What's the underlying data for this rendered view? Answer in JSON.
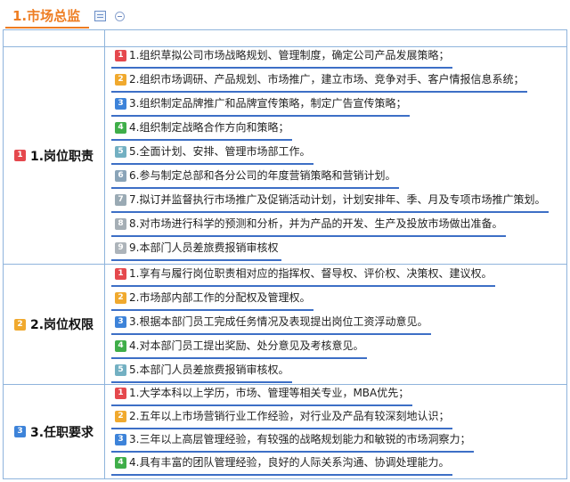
{
  "topic": {
    "title": "1.市场总监"
  },
  "sections": [
    {
      "label": "1.岗位职责",
      "badge": "1",
      "items": [
        {
          "badge": "1",
          "text": "1.组织草拟公司市场战略规划、管理制度，确定公司产品发展策略；"
        },
        {
          "badge": "2",
          "text": "2.组织市场调研、产品规划、市场推广，建立市场、竞争对手、客户情报信息系统；"
        },
        {
          "badge": "3",
          "text": "3.组织制定品牌推广和品牌宣传策略，制定广告宣传策略；"
        },
        {
          "badge": "4",
          "text": "4.组织制定战略合作方向和策略；"
        },
        {
          "badge": "5",
          "text": "5.全面计划、安排、管理市场部工作。"
        },
        {
          "badge": "6",
          "text": "6.参与制定总部和各分公司的年度营销策略和营销计划。"
        },
        {
          "badge": "7",
          "text": "7.拟订并监督执行市场推广及促销活动计划，计划安排年、季、月及专项市场推广策划。"
        },
        {
          "badge": "8",
          "text": "8.对市场进行科学的预测和分析，并为产品的开发、生产及投放市场做出准备。"
        },
        {
          "badge": "9",
          "text": "9.本部门人员差旅费报销审核权"
        }
      ]
    },
    {
      "label": "2.岗位权限",
      "badge": "2",
      "items": [
        {
          "badge": "1",
          "text": "1.享有与履行岗位职责相对应的指挥权、督导权、评价权、决策权、建议权。"
        },
        {
          "badge": "2",
          "text": "2.市场部内部工作的分配权及管理权。"
        },
        {
          "badge": "3",
          "text": "3.根据本部门员工完成任务情况及表现提出岗位工资浮动意见。"
        },
        {
          "badge": "4",
          "text": "4.对本部门员工提出奖励、处分意见及考核意见。"
        },
        {
          "badge": "5",
          "text": "5.本部门人员差旅费报销审核权。"
        }
      ]
    },
    {
      "label": "3.任职要求",
      "badge": "3",
      "items": [
        {
          "badge": "1",
          "text": "1.大学本科以上学历，市场、管理等相关专业，MBA优先；"
        },
        {
          "badge": "2",
          "text": "2.五年以上市场营销行业工作经验，对行业及产品有较深刻地认识；"
        },
        {
          "badge": "3",
          "text": "3.三年以上高层管理经验，有较强的战略规划能力和敏锐的市场洞察力；"
        },
        {
          "badge": "4",
          "text": "4.具有丰富的团队管理经验，良好的人际关系沟通、协调处理能力。"
        }
      ]
    }
  ]
}
